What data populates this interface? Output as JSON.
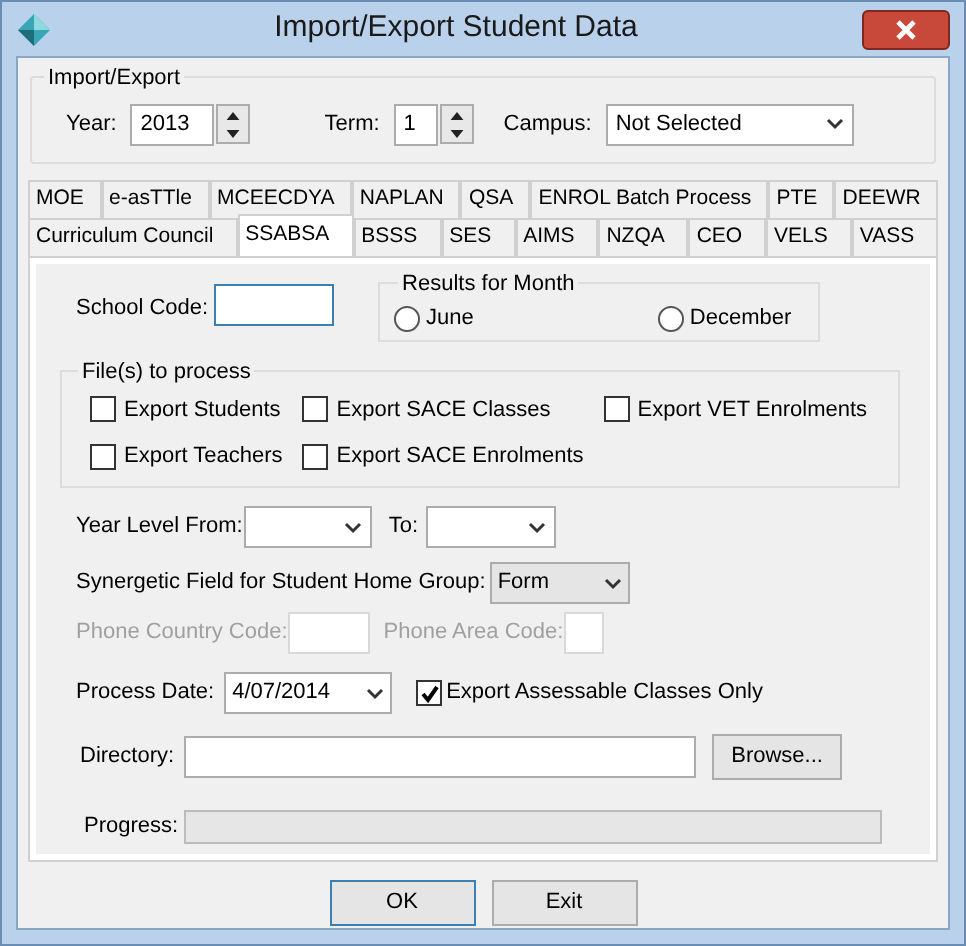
{
  "window": {
    "title": "Import/Export Student Data"
  },
  "import_export": {
    "label": "Import/Export",
    "year": {
      "label": "Year:",
      "value": "2013"
    },
    "term": {
      "label": "Term:",
      "value": "1"
    },
    "campus": {
      "label": "Campus:",
      "value": "Not Selected"
    }
  },
  "tab_rows": [
    [
      {
        "label": "MOE",
        "selected": false
      },
      {
        "label": "e-asTTle",
        "selected": false
      },
      {
        "label": "MCEECDYA",
        "selected": false
      },
      {
        "label": "NAPLAN",
        "selected": false
      },
      {
        "label": "QSA",
        "selected": false
      },
      {
        "label": "ENROL Batch Process",
        "selected": false
      },
      {
        "label": "PTE",
        "selected": false
      },
      {
        "label": "DEEWR",
        "selected": false
      }
    ],
    [
      {
        "label": "Curriculum Council",
        "selected": false
      },
      {
        "label": "SSABSA",
        "selected": true
      },
      {
        "label": "BSSS",
        "selected": false
      },
      {
        "label": "SES",
        "selected": false
      },
      {
        "label": "AIMS",
        "selected": false
      },
      {
        "label": "NZQA",
        "selected": false
      },
      {
        "label": "CEO",
        "selected": false
      },
      {
        "label": "VELS",
        "selected": false
      },
      {
        "label": "VASS",
        "selected": false
      }
    ]
  ],
  "school_code": {
    "label": "School Code:"
  },
  "results_for_month": {
    "label": "Results for Month",
    "options": [
      {
        "label": "June",
        "selected": false
      },
      {
        "label": "December",
        "selected": false
      }
    ]
  },
  "files_to_process": {
    "label": "File(s) to process",
    "options": [
      {
        "label": "Export Students",
        "checked": false
      },
      {
        "label": "Export SACE Classes",
        "checked": false
      },
      {
        "label": "Export VET Enrolments",
        "checked": false
      },
      {
        "label": "Export Teachers",
        "checked": false
      },
      {
        "label": "Export SACE Enrolments",
        "checked": false
      }
    ]
  },
  "year_level_from": {
    "label": "Year Level From:"
  },
  "year_level_to": {
    "label": "To:"
  },
  "home_group": {
    "label": "Synergetic Field for Student Home Group:",
    "value": "Form"
  },
  "phone_country_code": {
    "label": "Phone Country Code:",
    "disabled": true
  },
  "phone_area_code": {
    "label": "Phone Area Code:",
    "disabled": true
  },
  "process_date": {
    "label": "Process Date:",
    "value": "4/07/2014"
  },
  "assessable_only": {
    "label": "Export Assessable Classes Only",
    "checked": true
  },
  "directory": {
    "label": "Directory:"
  },
  "browse_button": "Browse...",
  "progress": {
    "label": "Progress:",
    "level": 0
  },
  "buttons": [
    {
      "label": "OK",
      "focused": true
    },
    {
      "label": "Exit",
      "focused": false
    }
  ]
}
